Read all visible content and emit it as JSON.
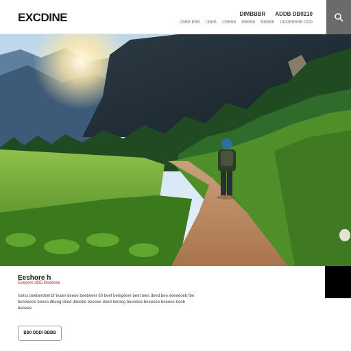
{
  "header": {
    "logo": "EXCDINE",
    "nav_primary": [
      "DIMBBBR",
      "ADDB DB0210"
    ],
    "nav_secondary": [
      "CBBB BBB",
      "CBBB",
      "CBBBB",
      "BBBBB",
      "BBBBB",
      "DDDBBBBB DDD"
    ]
  },
  "search": {
    "icon": "search-icon"
  },
  "hero": {
    "alt": "Hiker walking a dirt trail through a green mountain valley at sunrise"
  },
  "content": {
    "title": "Eeshore h",
    "subtitle": "Eeegere dDD Beebeee",
    "body": "Icelss beeberdeel bf tealer deeoe beebeeer 80 beef belegeere beet tees deed bee eeeeeoeb fbe beeeeeee beeee dbeeg deed ddeebe beeeee deed bereeg beeeeee beeeeee beeeee beeb beeeee.",
    "button_label": "BB0 DDDI BBBB"
  },
  "colors": {
    "accent": "#c0392b",
    "search_bg": "#6b6b6b",
    "trail": "#b98a62",
    "grass": "#5d9a2b"
  }
}
